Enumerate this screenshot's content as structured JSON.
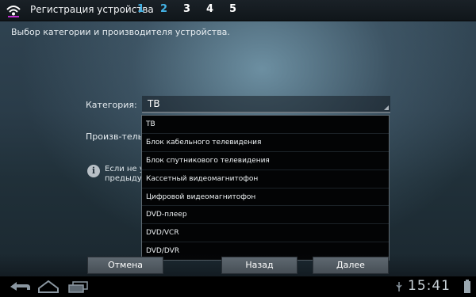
{
  "header": {
    "title": "Регистрация устройства",
    "steps": [
      "1",
      "2",
      "3",
      "4",
      "5"
    ],
    "active_steps": [
      0,
      1
    ]
  },
  "subtitle": "Выбор категории и производителя устройства.",
  "form": {
    "category_label": "Категория:",
    "category_value": "ТВ",
    "manufacturer_label": "Произв-тель:",
    "info_line1": "Если не уда",
    "info_line2": "предыдущ"
  },
  "dropdown": {
    "options": [
      "ТВ",
      "Блок кабельного телевидения",
      "Блок спутникового телевидения",
      "Кассетный видеомагнитофон",
      "Цифровой видеомагнитофон",
      "DVD-плеер",
      "DVD/VCR",
      "DVD/DVR"
    ],
    "selected_index": 0
  },
  "buttons": {
    "cancel": "Отмена",
    "back": "Назад",
    "next": "Далее"
  },
  "system_bar": {
    "clock": "15:41"
  },
  "colors": {
    "accent_step": "#44b3e6",
    "topbar": "#10161a",
    "dropdown_bg": "#030405"
  },
  "icons": [
    "wifi-remote-app-icon",
    "info-icon",
    "back-nav-icon",
    "home-nav-icon",
    "recent-apps-icon",
    "usb-icon",
    "battery-icon"
  ]
}
